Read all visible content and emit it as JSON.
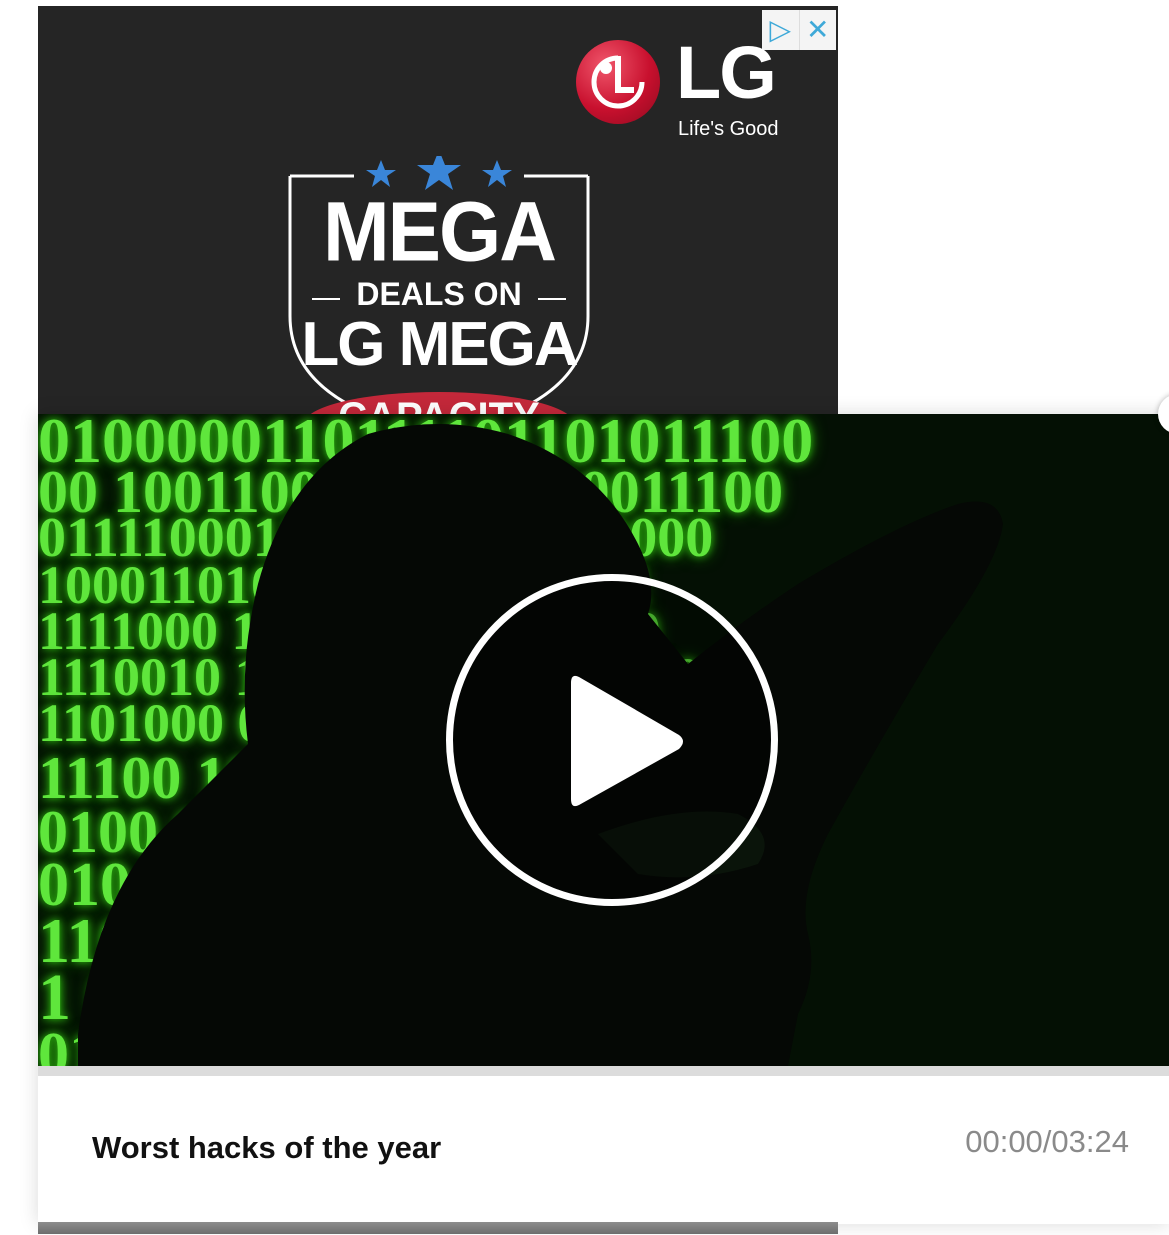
{
  "ad": {
    "brand": "LG",
    "tagline": "Life's Good",
    "headline": "MEGA",
    "subline": "DEALS ON",
    "product": "LG MEGA",
    "ribbon": "CAPACITY",
    "choices_icon": "adchoices-icon",
    "close_icon": "close-icon",
    "stars_color": "#3a86d9",
    "logo_color": "#c8102e"
  },
  "video": {
    "title": "Worst hacks of the year",
    "time_current": "00:00",
    "time_separator": "/",
    "time_total": "03:24",
    "progress": 0,
    "play_icon": "play-icon",
    "accent": "#2b7de9"
  }
}
